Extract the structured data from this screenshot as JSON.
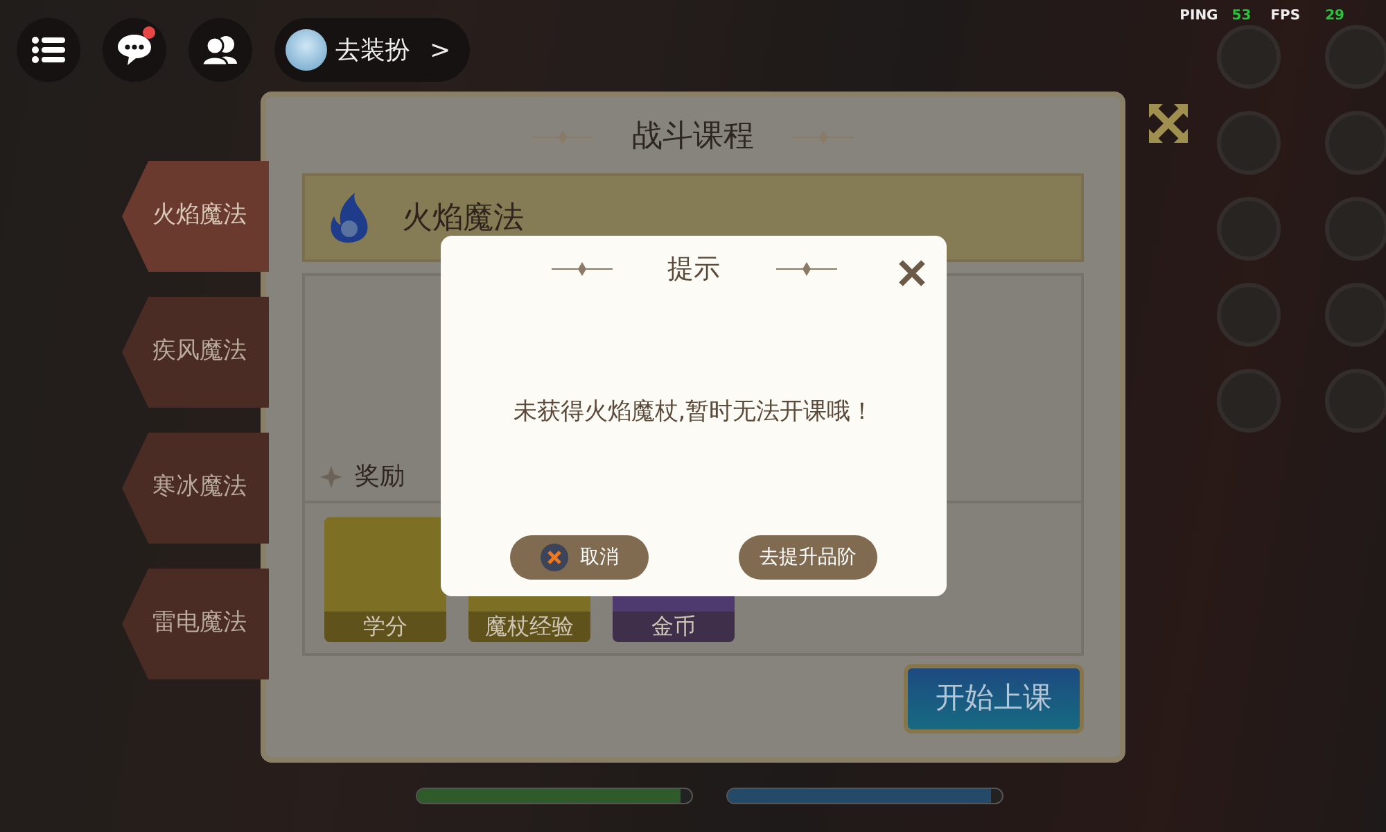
{
  "hud": {
    "chat_unread": true,
    "dress_up": {
      "label": "去装扮",
      "arrow": ">"
    }
  },
  "stats": {
    "ping_label": "PING",
    "ping": "53",
    "fps_label": "FPS",
    "fps": "29"
  },
  "tabs": [
    {
      "label": "火焰魔法",
      "selected": true
    },
    {
      "label": "疾风魔法",
      "selected": false
    },
    {
      "label": "寒冰魔法",
      "selected": false
    },
    {
      "label": "雷电魔法",
      "selected": false
    }
  ],
  "panel": {
    "title": "战斗课程",
    "course": "火焰魔法",
    "rewards_label": "奖励",
    "rewards": [
      {
        "label": "学分",
        "color": "#7d6f24"
      },
      {
        "label": "魔杖经验",
        "color": "#7d6f24"
      },
      {
        "label": "金币",
        "color": "#4e3a6e"
      }
    ],
    "start_button": "开始上课"
  },
  "dialog": {
    "title": "提示",
    "message": "未获得火焰魔杖,暂时无法开课哦！",
    "cancel": "取消",
    "confirm": "去提升品阶"
  },
  "status_bars": [
    {
      "level": 0.96,
      "color": "#2f5a2a"
    },
    {
      "level": 0.96,
      "color": "#244a6a"
    }
  ]
}
